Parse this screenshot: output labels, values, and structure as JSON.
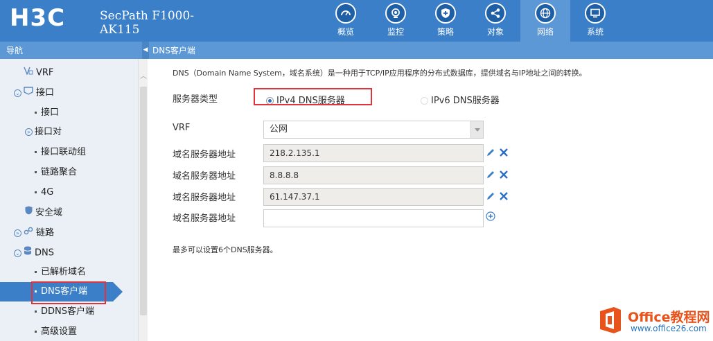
{
  "header": {
    "logo": "H3C",
    "product_line1": "SecPath F1000-",
    "product_line2": "AK115",
    "nav": [
      {
        "label": "概览",
        "icon": "gauge-icon"
      },
      {
        "label": "监控",
        "icon": "monitor-icon"
      },
      {
        "label": "策略",
        "icon": "shield-icon"
      },
      {
        "label": "对象",
        "icon": "share-icon"
      },
      {
        "label": "网络",
        "icon": "globe-icon",
        "active": true
      },
      {
        "label": "系统",
        "icon": "display-icon"
      }
    ]
  },
  "subbar": {
    "nav_label": "导航",
    "page_title": "DNS客户端"
  },
  "sidebar": {
    "items": [
      {
        "label": "VRF"
      },
      {
        "label": "接口"
      },
      {
        "label": "接口"
      },
      {
        "label": "接口对"
      },
      {
        "label": "接口联动组"
      },
      {
        "label": "链路聚合"
      },
      {
        "label": "4G"
      },
      {
        "label": "安全域"
      },
      {
        "label": "链路"
      },
      {
        "label": "DNS"
      },
      {
        "label": "已解析域名"
      },
      {
        "label": "DNS客户端"
      },
      {
        "label": "DDNS客户端"
      },
      {
        "label": "高级设置"
      }
    ]
  },
  "main": {
    "description": "DNS（Domain Name System，域名系统）是一种用于TCP/IP应用程序的分布式数据库，提供域名与IP地址之间的转换。",
    "server_type_label": "服务器类型",
    "ipv4_option": "IPv4 DNS服务器",
    "ipv6_option": "IPv6 DNS服务器",
    "vrf_label": "VRF",
    "vrf_value": "公网",
    "server_addr_label": "域名服务器地址",
    "servers": [
      "218.2.135.1",
      "8.8.8.8",
      "61.147.37.1",
      ""
    ],
    "note": "最多可以设置6个DNS服务器。"
  },
  "watermark": {
    "line1": "Office教程网",
    "line2": "www.office26.com"
  },
  "colors": {
    "header_bg": "#3a7fc8",
    "active_nav": "#5d98d6",
    "sidebar_bg": "#eaf0f6",
    "highlight_red": "#e0333c"
  }
}
